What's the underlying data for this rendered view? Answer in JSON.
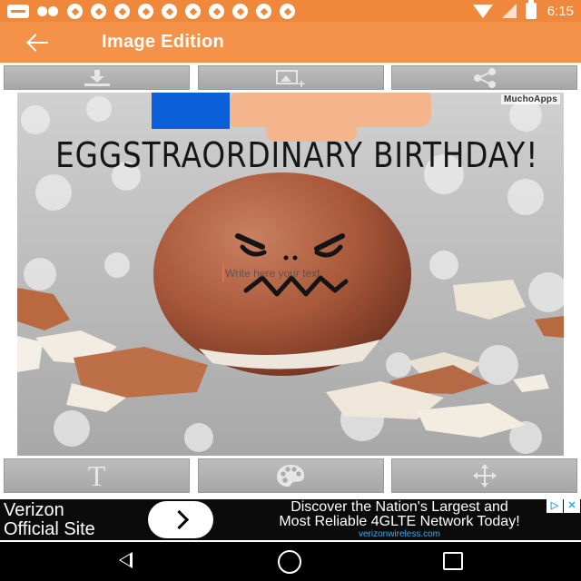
{
  "status_bar": {
    "time": "6:15",
    "icons": [
      "message-icon",
      "group-icon",
      "soccer-ball-icon",
      "wifi-icon",
      "signal-icon",
      "battery-icon"
    ]
  },
  "app_bar": {
    "title": "Image Edition",
    "back_icon": "back-arrow-icon",
    "background": "#f5924a"
  },
  "top_toolbar": {
    "buttons": [
      {
        "name": "download",
        "icon": "download-icon"
      },
      {
        "name": "add-image",
        "icon": "add-image-icon"
      },
      {
        "name": "share",
        "icon": "share-icon"
      }
    ]
  },
  "image": {
    "watermark": "MuchoApps",
    "headline": "EGGSTRAORDINARY BIRTHDAY!",
    "overlay_placeholder": "Write here your text",
    "subject": "angry-face egg with broken shells"
  },
  "bottom_toolbar": {
    "buttons": [
      {
        "name": "text",
        "icon": "text-icon",
        "glyph": "T"
      },
      {
        "name": "color",
        "icon": "palette-icon"
      },
      {
        "name": "move",
        "icon": "move-icon"
      }
    ]
  },
  "ad": {
    "left_line1": "Verizon",
    "left_line2": "Official Site",
    "headline_line1": "Discover the Nation's Largest and",
    "headline_line2": "Most Reliable 4GLTE Network Today!",
    "url": "verizonwireless.com"
  },
  "nav_bar": {
    "icons": [
      "nav-back-icon",
      "nav-home-icon",
      "nav-recents-icon"
    ]
  },
  "colors": {
    "accent": "#f5924a",
    "status_bar": "#f0883c",
    "toolbar_button": "#b3b3b3",
    "ad_url": "#39a9f4"
  }
}
